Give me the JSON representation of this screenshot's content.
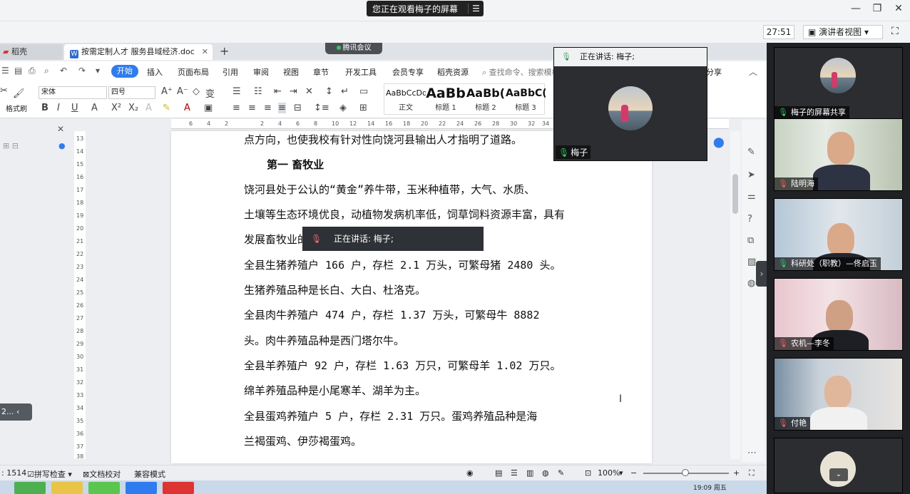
{
  "meeting": {
    "viewing_banner": "您正在观看梅子的屏幕",
    "timer": "27:51",
    "speaker_view": "演讲者视图",
    "speaking_label": "正在讲话: 梅子;",
    "speaking_toast": "正在讲话: 梅子;",
    "float_name": "梅子",
    "tencent_tab": "腾讯会议"
  },
  "wps": {
    "tabs": [
      {
        "label": "稻壳"
      },
      {
        "label": "按需定制人才 服务县域经济.doc"
      }
    ],
    "menu": [
      "插入",
      "页面布局",
      "引用",
      "审阅",
      "视图",
      "章节",
      "开发工具",
      "会员专享",
      "稻壳资源"
    ],
    "start_label": "开始",
    "search_placeholder": "查找命令、搜索模板",
    "share_label": "分享",
    "font_name": "宋体",
    "font_size": "四号",
    "format_painter": "格式刷",
    "styles": [
      {
        "preview": "AaBbCcDd",
        "name": "正文"
      },
      {
        "preview": "AaBb",
        "name": "标题 1"
      },
      {
        "preview": "AaBb(",
        "name": "标题 2"
      },
      {
        "preview": "AaBbC(",
        "name": "标题 3"
      }
    ],
    "ruler_h": [
      "6",
      "4",
      "2",
      "2",
      "4",
      "6",
      "8",
      "10",
      "12",
      "14",
      "16",
      "18",
      "20",
      "22",
      "24",
      "26",
      "28",
      "30",
      "32",
      "34",
      "36"
    ],
    "ruler_v": [
      "13",
      "14",
      "15",
      "16",
      "17",
      "18",
      "19",
      "20",
      "21",
      "22",
      "23",
      "24",
      "25",
      "26",
      "27",
      "28",
      "29",
      "30",
      "31",
      "32",
      "33",
      "34",
      "35",
      "36",
      "37",
      "38"
    ],
    "status": {
      "word_count": ": 1514",
      "spell_check": "拼写检查",
      "doc_proof": "文档校对",
      "compat_mode": "兼容模式",
      "zoom": "100%"
    },
    "left_collapse_text": "2..."
  },
  "document": {
    "lines": [
      "点方向，也使我校有针对性向饶河县输出人才指明了道路。",
      "第一 畜牧业",
      "  饶河县处于公认的“黄金”养牛带，玉米种植带，大气、水质、",
      "土壤等生态环境优良，动植物发病机率低，饲草饲料资源丰富，具有",
      "发展畜牧业的",
      "  全县生猪养殖户 166 户，存栏 2.1 万头，可繁母猪 2480 头。",
      "生猪养殖品种是长白、大白、杜洛克。",
      "  全县肉牛养殖户 474 户，存栏 1.37 万头，可繁母牛 8882",
      "头。肉牛养殖品种是西门塔尔牛。",
      "  全县羊养殖户 92 户，存栏 1.63 万只，可繁母羊 1.02 万只。",
      "绵羊养殖品种是小尾寒羊、湖羊为主。",
      "  全县蛋鸡养殖户 5 户，存栏 2.31 万只。蛋鸡养殖品种是海",
      "兰褐蛋鸡、伊莎褐蛋鸡。"
    ]
  },
  "participants": [
    {
      "name": "梅子的屏幕共享",
      "mic": "on"
    },
    {
      "name": "陆明海",
      "mic": "off"
    },
    {
      "name": "科研处（职教）—佟启玉",
      "mic": "on"
    },
    {
      "name": "农机—李冬",
      "mic": "off"
    },
    {
      "name": "付艳",
      "mic": "off"
    }
  ],
  "taskbar": {
    "clock": "19:09 周五"
  },
  "colors": {
    "accent": "#2f7bf0",
    "mic_on": "#2fcf67",
    "mic_off": "#ff5a5a"
  }
}
